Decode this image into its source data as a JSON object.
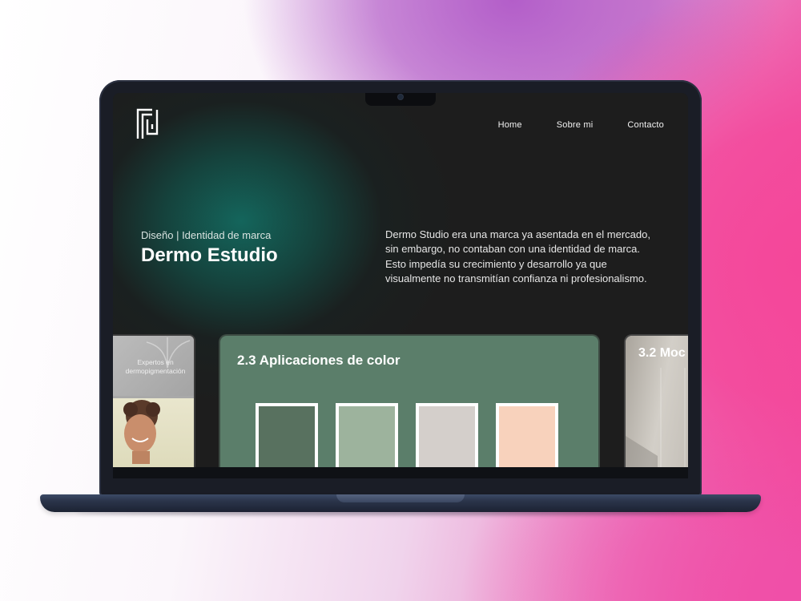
{
  "nav": {
    "items": [
      "Home",
      "Sobre mi",
      "Contacto"
    ]
  },
  "hero": {
    "kicker": "Diseño | Identidad de marca",
    "title": "Dermo Estudio",
    "description": "Dermo Studio era una marca ya asentada en el mercado, sin embargo, no contaban con una identidad de marca. Esto impedía su crecimiento y desarrollo ya que visualmente no transmitían confianza ni profesionalismo."
  },
  "cards": {
    "left": {
      "text": "Expertos en dermopigmentación"
    },
    "main": {
      "heading": "2.3 Aplicaciones de color",
      "swatches": [
        "#58715f",
        "#9db39d",
        "#d4cfcb",
        "#f8d2bc"
      ]
    },
    "right": {
      "heading": "3.2 Moc"
    }
  },
  "colors": {
    "accent_green": "#5b7e6a",
    "screen_background": "#1d1d1d"
  }
}
